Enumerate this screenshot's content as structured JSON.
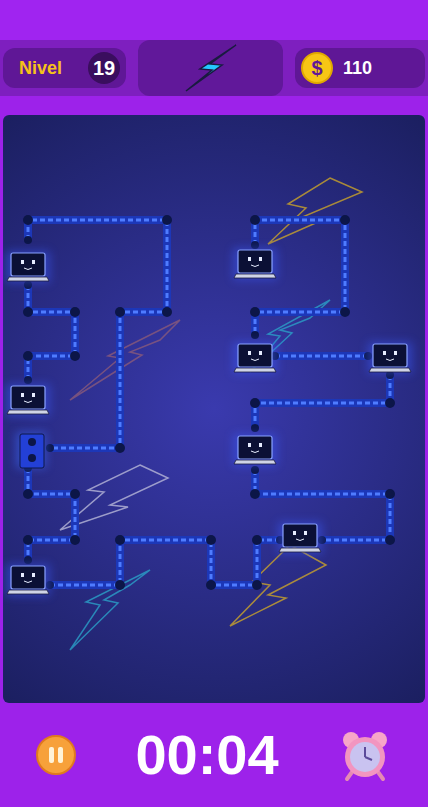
{
  "header": {
    "level_label": "Nivel",
    "level": "19",
    "coin_symbol": "$",
    "coins": "110"
  },
  "timer": "00:04"
}
